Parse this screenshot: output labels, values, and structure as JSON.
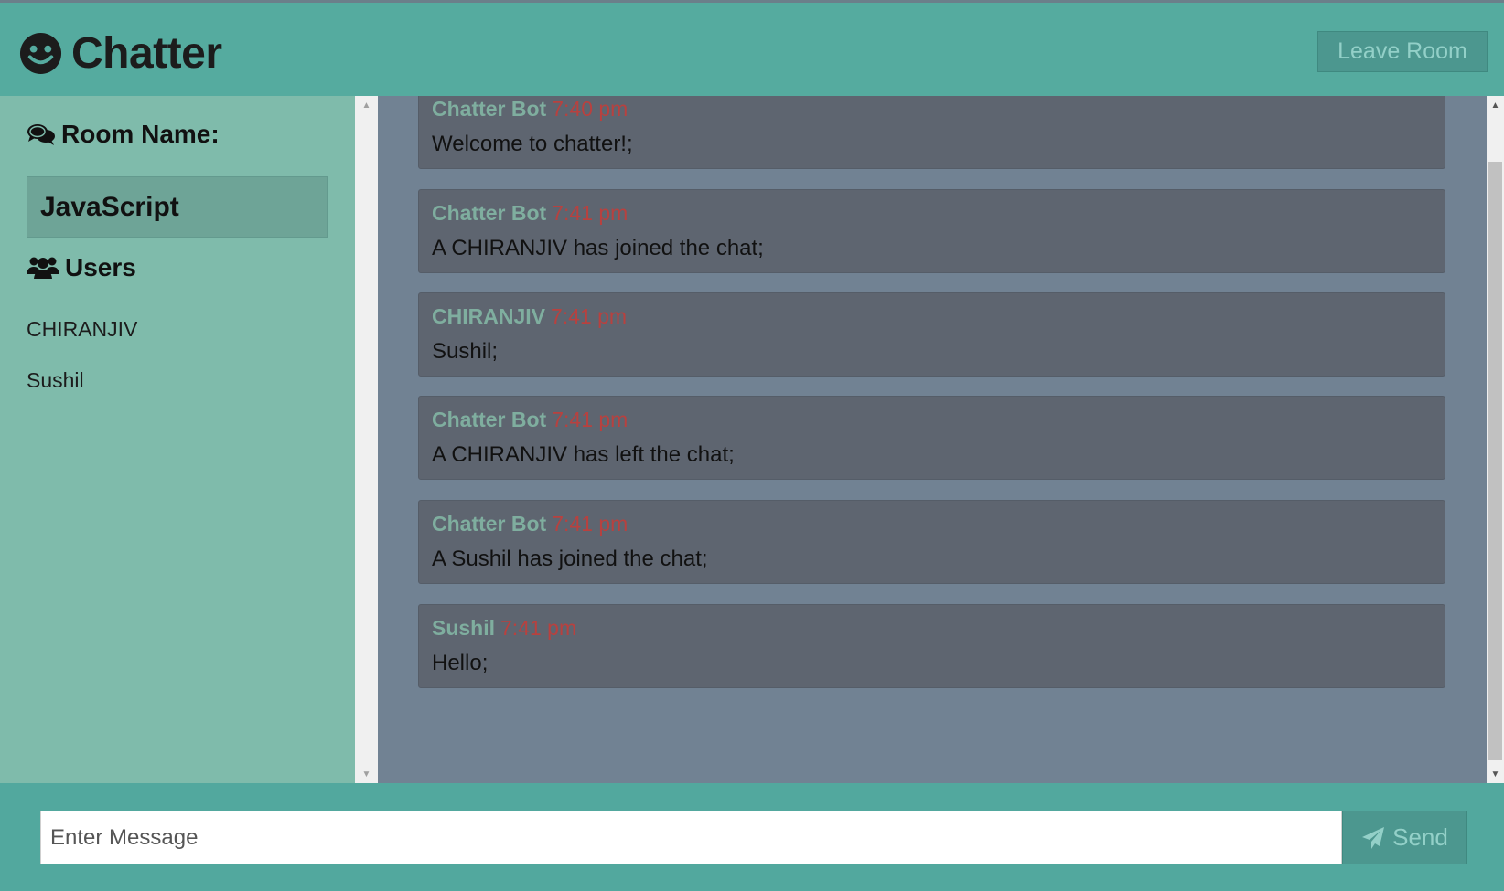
{
  "app": {
    "title": "Chatter",
    "leave_label": "Leave Room"
  },
  "sidebar": {
    "room_heading": "Room Name:",
    "room_name": "JavaScript",
    "users_heading": "Users",
    "users": [
      "CHIRANJIV",
      "Sushil"
    ]
  },
  "messages": [
    {
      "user": "Chatter Bot",
      "time": "7:40 pm",
      "text": "Welcome to chatter!;"
    },
    {
      "user": "Chatter Bot",
      "time": "7:41 pm",
      "text": "A CHIRANJIV has joined the chat;"
    },
    {
      "user": "CHIRANJIV",
      "time": "7:41 pm",
      "text": "Sushil;"
    },
    {
      "user": "Chatter Bot",
      "time": "7:41 pm",
      "text": "A CHIRANJIV has left the chat;"
    },
    {
      "user": "Chatter Bot",
      "time": "7:41 pm",
      "text": "A Sushil has joined the chat;"
    },
    {
      "user": "Sushil",
      "time": "7:41 pm",
      "text": "Hello;"
    }
  ],
  "composer": {
    "placeholder": "Enter Message",
    "value": "",
    "send_label": "Send"
  },
  "icons": {
    "logo": "smiley-icon",
    "room": "comments-icon",
    "users": "users-icon",
    "send": "paper-plane-icon"
  },
  "colors": {
    "header_bg": "#55ab9f",
    "sidebar_bg": "#7fbbab",
    "chat_bg": "#718293",
    "message_bg": "#5e6570",
    "username": "#7fae9f",
    "timestamp": "#b8413f"
  }
}
